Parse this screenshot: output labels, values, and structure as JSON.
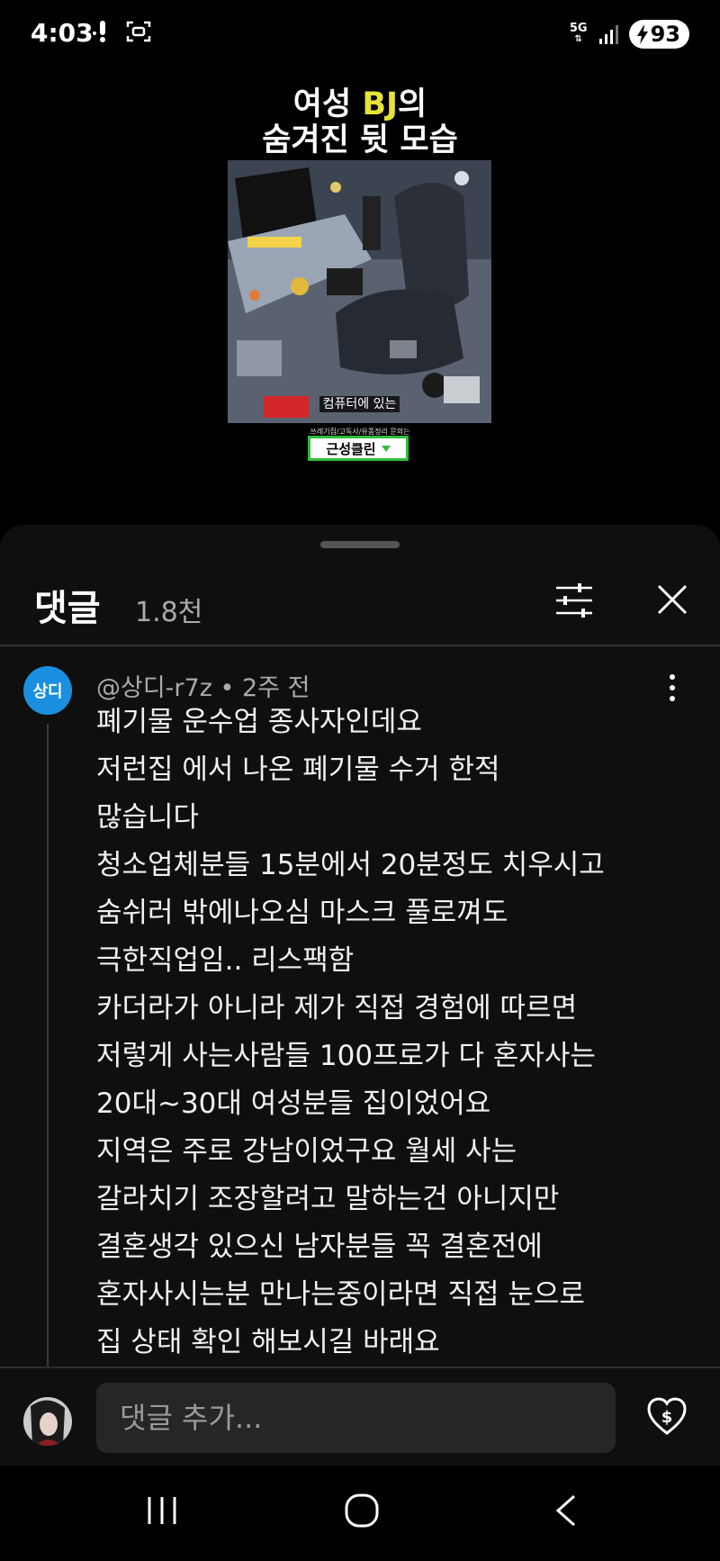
{
  "status_bar": {
    "time": "4:03",
    "network": "5G",
    "battery": "93",
    "icons": [
      "notification-icon",
      "screen-capture-icon",
      "signal-icon",
      "battery-charging-icon"
    ]
  },
  "video": {
    "title_line1_a": "여성 ",
    "title_line1_b": "BJ",
    "title_line1_c": "의",
    "title_line2": "숨겨진 뒷 모습",
    "thumb_caption": "컴퓨터에 있는",
    "brand_small": "쓰레기집/고독사/유품정리 문의는",
    "brand_name": "근성클린"
  },
  "comments_sheet": {
    "title": "댓글",
    "count": "1.8천",
    "icons": [
      "filter-icon",
      "close-icon"
    ]
  },
  "comment": {
    "avatar_text": "상디",
    "author": "@상디-r7z",
    "time": "2주 전",
    "lines": [
      "폐기물 운수업 종사자인데요",
      "저런집 에서 나온 폐기물 수거 한적",
      "많습니다",
      "청소업체분들 15분에서 20분정도 치우시고",
      "숨쉬러 밖에나오심 마스크 풀로껴도",
      "극한직업임.. 리스팩함",
      "카더라가 아니라 제가 직접 경험에 따르면",
      "저렇게 사는사람들 100프로가 다 혼자사는",
      "20대~30대 여성분들 집이었어요",
      "지역은 주로 강남이었구요 월세 사는",
      "갈라치기 조장할려고 말하는건 아니지만",
      "결혼생각 있으신 남자분들 꼭 결혼전에",
      "혼자사시는분 만나는중이라면 직접 눈으로",
      "집 상태 확인 해보시길 바래요"
    ]
  },
  "add_comment": {
    "placeholder": "댓글 추가..."
  },
  "nav": {
    "icons": [
      "recent-apps-icon",
      "home-icon",
      "back-icon"
    ]
  }
}
